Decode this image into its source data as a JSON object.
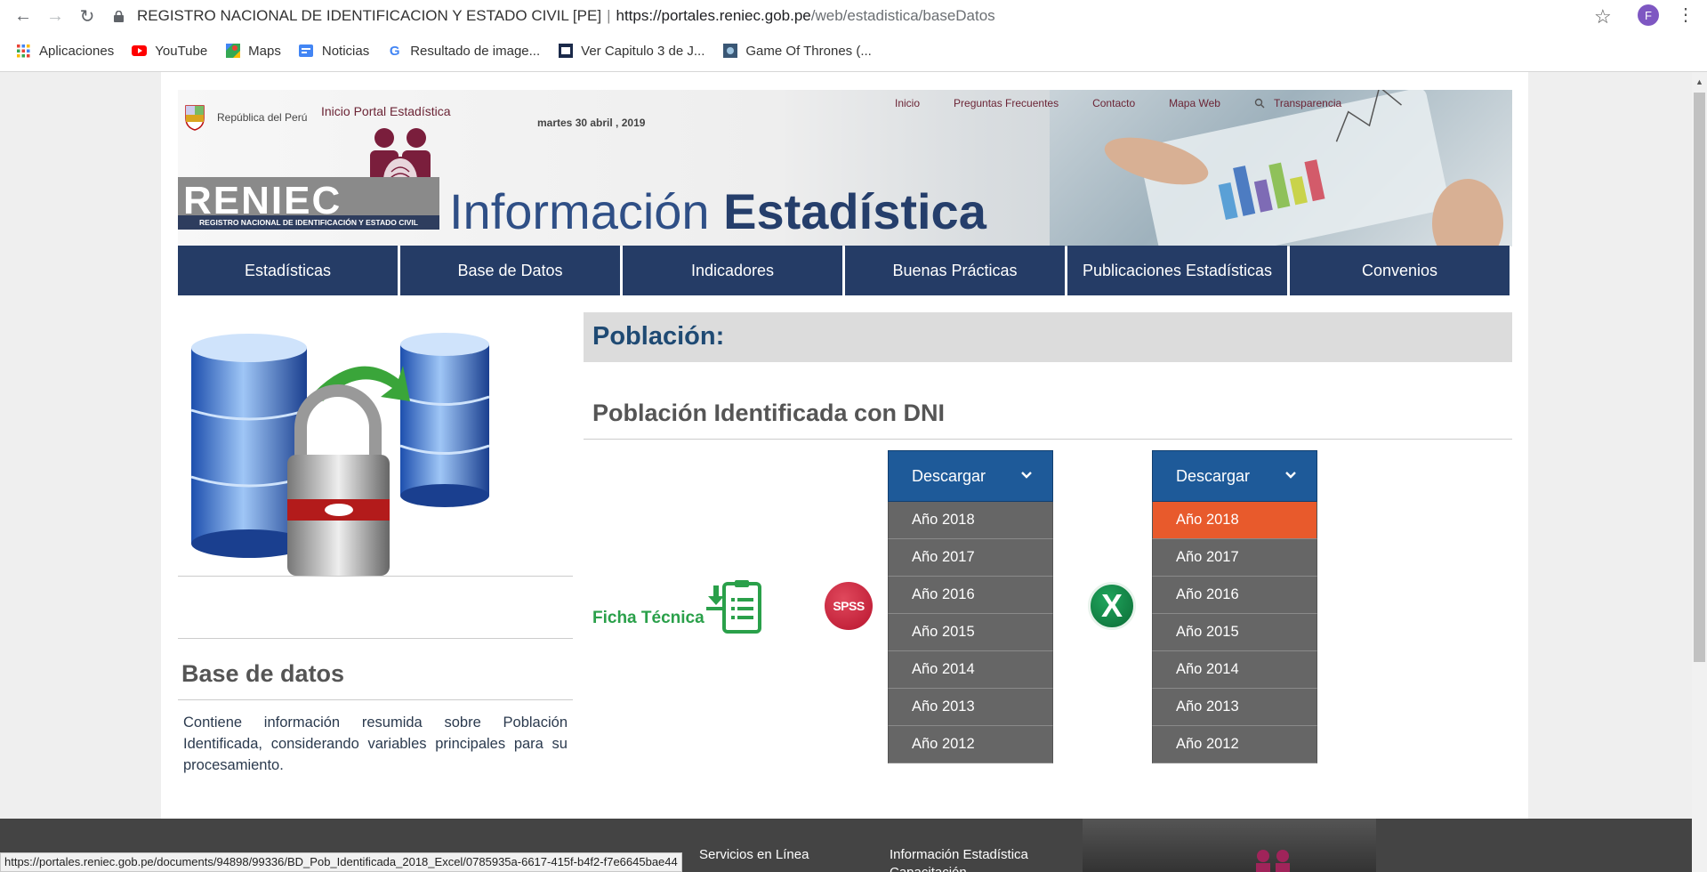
{
  "browser": {
    "site_name": "REGISTRO NACIONAL DE IDENTIFICACION Y ESTADO CIVIL [PE]",
    "url_host": "https://portales.reniec.gob.pe",
    "url_path": "/web/estadistica/baseDatos",
    "profile_initial": "F",
    "bookmarks": [
      "Aplicaciones",
      "YouTube",
      "Maps",
      "Noticias",
      "Resultado de image...",
      "Ver Capitulo 3 de J...",
      "Game Of Thrones (..."
    ],
    "status_url": "https://portales.reniec.gob.pe/documents/94898/99336/BD_Pob_Identificada_2018_Excel/0785935a-6617-415f-b4f2-f7e6645bae44"
  },
  "header": {
    "republica": "República del Perú",
    "portal_link": "Inicio Portal Estadística",
    "date": "martes 30 abril , 2019",
    "top_links": [
      "Inicio",
      "Preguntas Frecuentes",
      "Contacto",
      "Mapa Web",
      "Transparencia"
    ],
    "logo_text": "RENIEC",
    "logo_subtitle": "REGISTRO NACIONAL DE IDENTIFICACIÓN Y ESTADO CIVIL",
    "title_light": "Información",
    "title_bold": "Estadística"
  },
  "menu": [
    "Estadísticas",
    "Base de Datos",
    "Indicadores",
    "Buenas Prácticas",
    "Publicaciones Estadísticas",
    "Convenios"
  ],
  "sidebar": {
    "title": "Base de datos",
    "description": "Contiene información resumida sobre Población Identificada, considerando variables principales para su procesamiento."
  },
  "main": {
    "section_title": "Población:",
    "subtitle": "Población Identificada con DNI",
    "ficha_label": "Ficha Técnica",
    "spss_label": "SPSS",
    "excel_label": "X",
    "dropdowns": [
      {
        "label": "Descargar",
        "items": [
          "Año 2018",
          "Año 2017",
          "Año 2016",
          "Año 2015",
          "Año 2014",
          "Año 2013",
          "Año 2012"
        ],
        "highlighted": -1
      },
      {
        "label": "Descargar",
        "items": [
          "Año 2018",
          "Año 2017",
          "Año 2016",
          "Año 2015",
          "Año 2014",
          "Año 2013",
          "Año 2012"
        ],
        "highlighted": 0
      }
    ]
  },
  "footer": {
    "items": [
      "Servicios en Línea",
      "Información Estadística",
      "Capacitación"
    ]
  },
  "colors": {
    "menu_bg": "#253c66",
    "dropdown_head": "#1e5a99",
    "dropdown_item": "#666666",
    "highlight": "#e85a2c"
  }
}
